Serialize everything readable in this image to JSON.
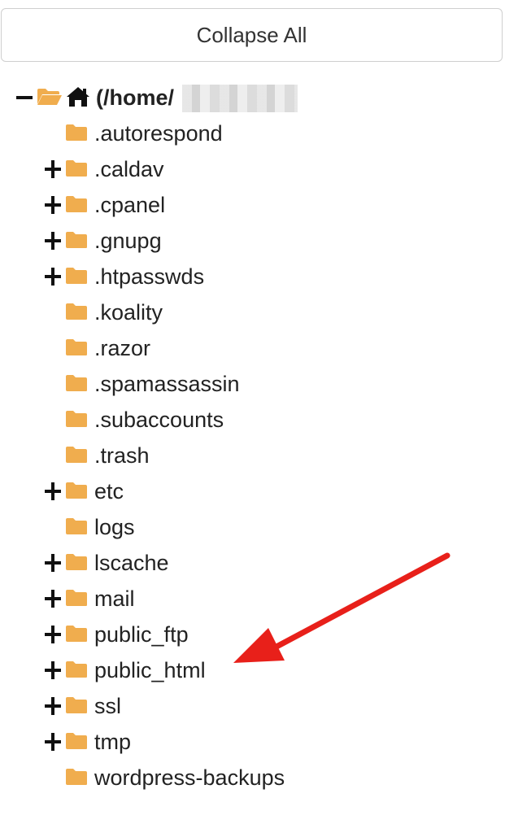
{
  "toolbar": {
    "collapse_label": "Collapse All"
  },
  "root": {
    "label": "(/home/",
    "expanded": true
  },
  "items": [
    {
      "label": ".autorespond",
      "expandable": false
    },
    {
      "label": ".caldav",
      "expandable": true
    },
    {
      "label": ".cpanel",
      "expandable": true
    },
    {
      "label": ".gnupg",
      "expandable": true
    },
    {
      "label": ".htpasswds",
      "expandable": true
    },
    {
      "label": ".koality",
      "expandable": false
    },
    {
      "label": ".razor",
      "expandable": false
    },
    {
      "label": ".spamassassin",
      "expandable": false
    },
    {
      "label": ".subaccounts",
      "expandable": false
    },
    {
      "label": ".trash",
      "expandable": false
    },
    {
      "label": "etc",
      "expandable": true
    },
    {
      "label": "logs",
      "expandable": false
    },
    {
      "label": "lscache",
      "expandable": true
    },
    {
      "label": "mail",
      "expandable": true
    },
    {
      "label": "public_ftp",
      "expandable": true
    },
    {
      "label": "public_html",
      "expandable": true
    },
    {
      "label": "ssl",
      "expandable": true
    },
    {
      "label": "tmp",
      "expandable": true
    },
    {
      "label": "wordpress-backups",
      "expandable": false
    }
  ],
  "colors": {
    "folder": "#f0ad4e",
    "arrow": "#e8201a"
  }
}
